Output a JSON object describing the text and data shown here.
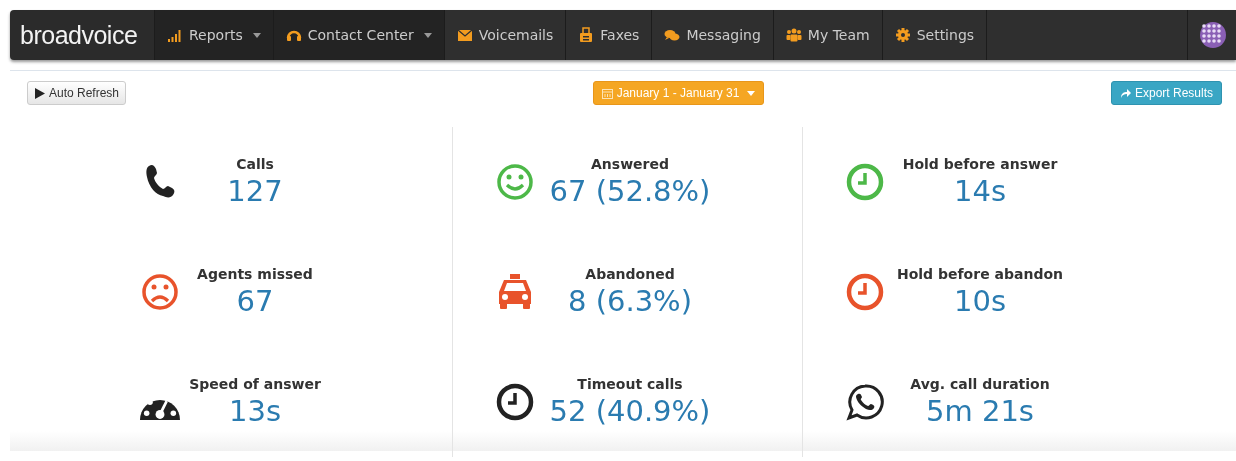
{
  "nav": {
    "logo": "broadvoice",
    "items": [
      {
        "label": "Reports",
        "dropdown": true
      },
      {
        "label": "Contact Center",
        "dropdown": true
      },
      {
        "label": "Voicemails",
        "dropdown": false
      },
      {
        "label": "Faxes",
        "dropdown": false
      },
      {
        "label": "Messaging",
        "dropdown": false
      },
      {
        "label": "My Team",
        "dropdown": false
      },
      {
        "label": "Settings",
        "dropdown": false
      }
    ]
  },
  "toolbar": {
    "auto_refresh": "Auto Refresh",
    "date_range": "January 1 - January 31",
    "export": "Export Results"
  },
  "stats": [
    {
      "label": "Calls",
      "value": "127",
      "color": "#222222"
    },
    {
      "label": "Answered",
      "value": "67 (52.8%)",
      "color": "#4db848"
    },
    {
      "label": "Hold before answer",
      "value": "14s",
      "color": "#4db848"
    },
    {
      "label": "Agents missed",
      "value": "67",
      "color": "#e8532b"
    },
    {
      "label": "Abandoned",
      "value": "8 (6.3%)",
      "color": "#e8532b"
    },
    {
      "label": "Hold before abandon",
      "value": "10s",
      "color": "#e8532b"
    },
    {
      "label": "Speed of answer",
      "value": "13s",
      "color": "#222222"
    },
    {
      "label": "Timeout calls",
      "value": "52 (40.9%)",
      "color": "#222222"
    },
    {
      "label": "Avg. call duration",
      "value": "5m 21s",
      "color": "#222222"
    }
  ]
}
